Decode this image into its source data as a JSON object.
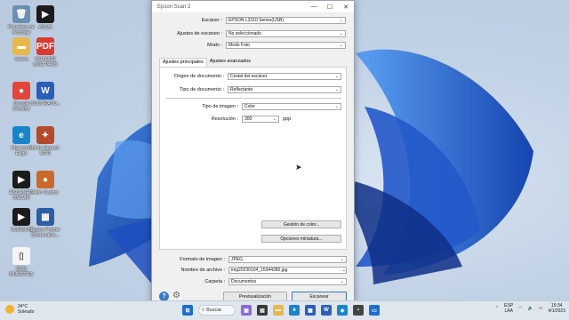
{
  "desktop": {
    "icons": [
      {
        "label": "Papelera de reciclaje",
        "glyph": "🗑",
        "color": "#6b8fb3"
      },
      {
        "label": "ASUS",
        "glyph": "▶",
        "color": "#1b1b1b"
      },
      {
        "label": "nuevo",
        "glyph": "▬",
        "color": "#e8b84a"
      },
      {
        "label": "CHANGE LOG PACK",
        "glyph": "PDF",
        "color": "#d83b2f"
      },
      {
        "label": "Google Chrome",
        "glyph": "●",
        "color": "#e2463a"
      },
      {
        "label": "CONTRATO...",
        "glyph": "W",
        "color": "#2b5eb8"
      },
      {
        "label": "Microsoft Edge",
        "glyph": "e",
        "color": "#1a84c9"
      },
      {
        "label": "Moto Search MPD",
        "glyph": "✦",
        "color": "#b34a2a"
      },
      {
        "label": "ESCANEO OSCAR",
        "glyph": "▶",
        "color": "#1b1b1b"
      },
      {
        "label": "Aldo Casino",
        "glyph": "●",
        "color": "#c96a2c"
      },
      {
        "label": "CURSOS",
        "glyph": "▶",
        "color": "#1b1b1b"
      },
      {
        "label": "Epson Printer Connection...",
        "glyph": "▦",
        "color": "#2a5fa6"
      },
      {
        "label": "2023 MUESTRA",
        "glyph": "▯",
        "color": "#f4f4f4"
      }
    ]
  },
  "window": {
    "title": "Epson Scan 2",
    "controls": {
      "minimize": "—",
      "maximize": "☐",
      "close": "✕"
    },
    "scanner_label": "Escáner :",
    "scanner_value": "EPSON L3210 Series(USB)",
    "settings_label": "Ajustes de escaneo :",
    "settings_value": "No seleccionado",
    "mode_label": "Modo :",
    "mode_value": "Modo Foto",
    "tabs": [
      "Ajustes principales",
      "Ajustes avanzados"
    ],
    "doc_source_label": "Origen de documento :",
    "doc_source_value": "Cristal del escáner",
    "doc_type_label": "Tipo de documento :",
    "doc_type_value": "Reflectante",
    "image_type_label": "Tipo de imagen :",
    "image_type_value": "Color",
    "resolution_label": "Resolución :",
    "resolution_value": "300",
    "resolution_unit": "ppp",
    "color_mgmt_button": "Gestión de color...",
    "thumb_options_button": "Opciones miniatura...",
    "image_format_label": "Formato de imagen :",
    "image_format_value": "JPEG",
    "filename_label": "Nombre de archivo :",
    "filename_value": "img20230104_15344280.jpg",
    "folder_label": "Carpeta :",
    "folder_value": "Documentos",
    "preview_button": "Previsualización",
    "scan_button": "Escanear"
  },
  "taskbar": {
    "weather_temp": "24°C",
    "weather_desc": "Soleado",
    "search_label": "Buscar",
    "lang_top": "ESP",
    "lang_bottom": "LAA",
    "time": "15:34",
    "date": "4/1/2023"
  }
}
